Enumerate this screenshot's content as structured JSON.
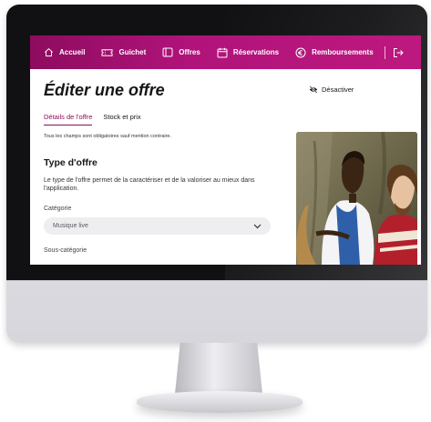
{
  "nav": {
    "items": [
      {
        "label": "Accueil",
        "icon": "home-icon"
      },
      {
        "label": "Guichet",
        "icon": "ticket-icon"
      },
      {
        "label": "Offres",
        "icon": "offers-icon"
      },
      {
        "label": "Réservations",
        "icon": "calendar-icon"
      },
      {
        "label": "Remboursements",
        "icon": "euro-icon"
      }
    ],
    "logout_icon": "logout-icon",
    "brand_color": "#b0137a"
  },
  "page": {
    "title": "Éditer une offre",
    "deactivate_label": "Désactiver",
    "deactivate_icon": "eye-off-icon"
  },
  "tabs": [
    {
      "label": "Détails de l'offre",
      "active": true
    },
    {
      "label": "Stock et prix",
      "active": false
    }
  ],
  "form": {
    "hint": "Tous les champs sont obligatoires sauf mention contraire.",
    "section_title": "Type d'offre",
    "section_description": "Le type de l'offre permet de la caractériser et de la valoriser au mieux dans l'application.",
    "category_label": "Catégorie",
    "category_value": "Musique live",
    "subcategory_label": "Sous-catégorie"
  }
}
